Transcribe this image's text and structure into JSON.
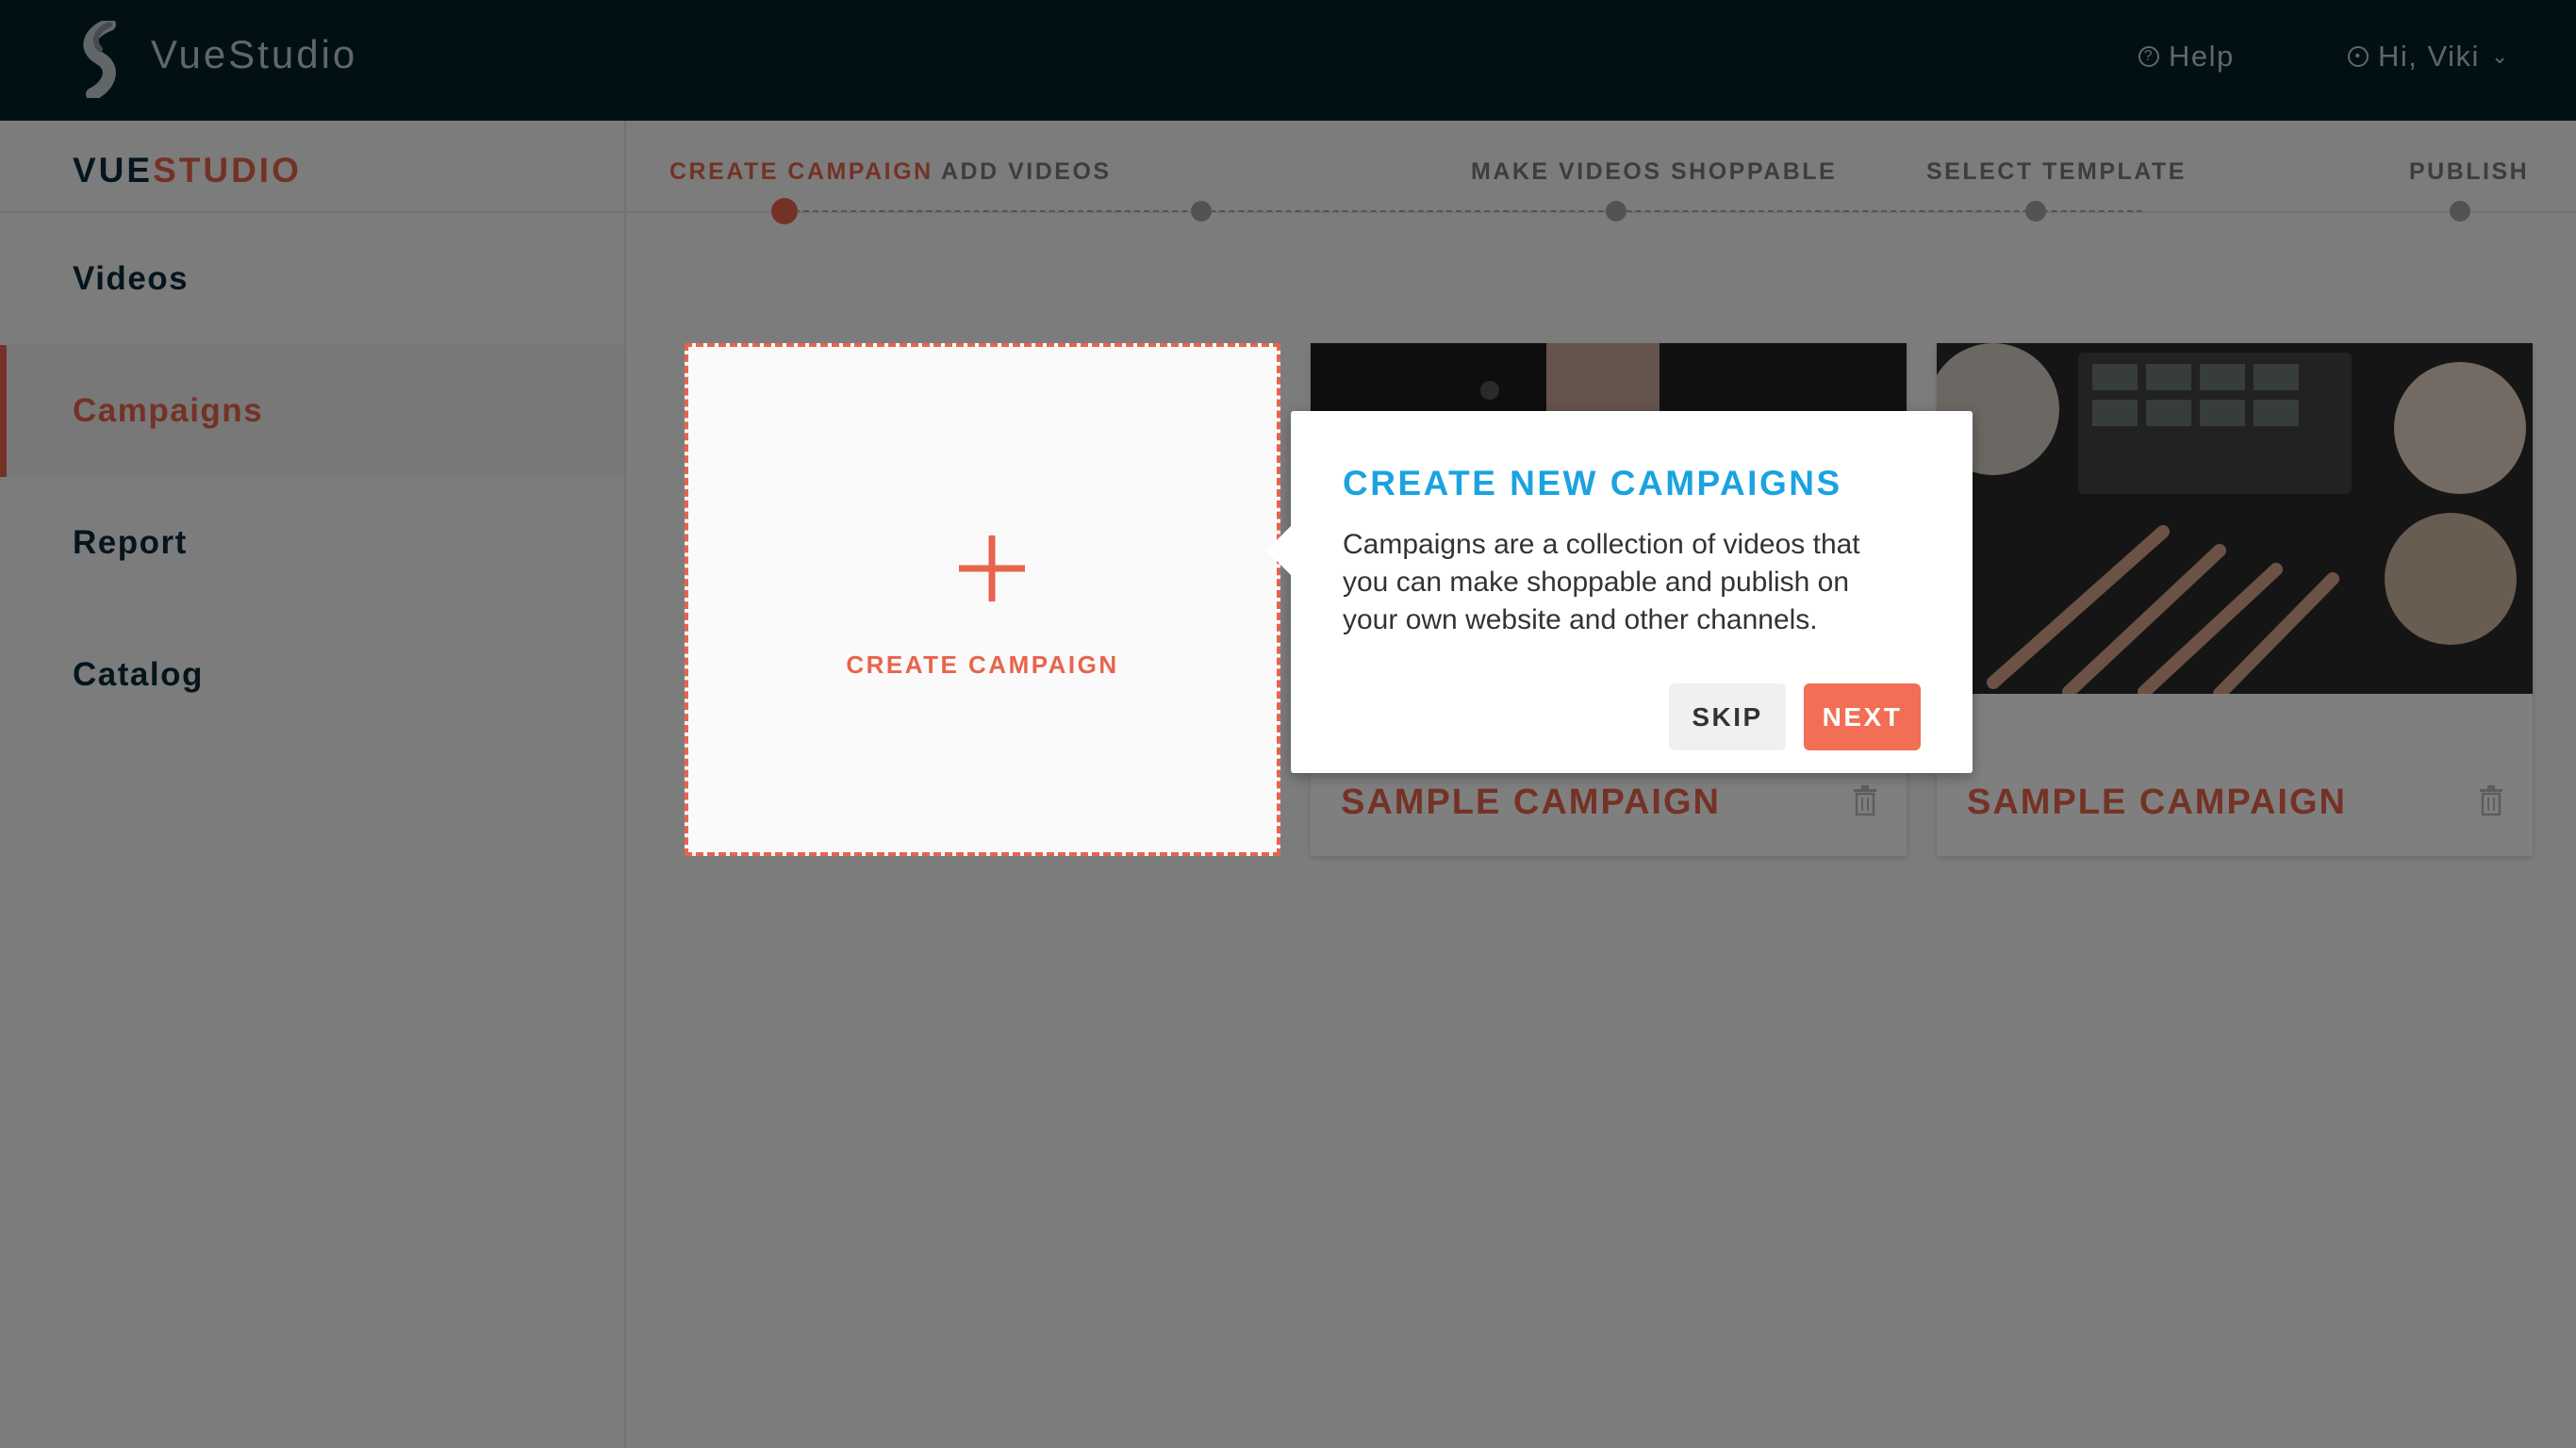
{
  "header": {
    "app_name": "VueStudio",
    "help_label": "Help",
    "user_greeting": "Hi, Viki"
  },
  "sidebar": {
    "brand_part1": "VUE",
    "brand_part2": "STUDIO",
    "items": [
      {
        "label": "Videos",
        "active": false
      },
      {
        "label": "Campaigns",
        "active": true
      },
      {
        "label": "Report",
        "active": false
      },
      {
        "label": "Catalog",
        "active": false
      }
    ]
  },
  "stepper": {
    "steps": [
      {
        "label": "CREATE CAMPAIGN",
        "active": true
      },
      {
        "label": "ADD VIDEOS",
        "active": false
      },
      {
        "label": "MAKE VIDEOS SHOPPABLE",
        "active": false
      },
      {
        "label": "SELECT TEMPLATE",
        "active": false
      },
      {
        "label": "PUBLISH",
        "active": false
      }
    ]
  },
  "main": {
    "create_card_label": "CREATE CAMPAIGN",
    "campaigns": [
      {
        "title": "SAMPLE CAMPAIGN"
      },
      {
        "title": "SAMPLE CAMPAIGN"
      }
    ]
  },
  "popover": {
    "title": "CREATE NEW CAMPAIGNS",
    "body": "Campaigns are a collection of videos that you can make shoppable and publish on your own website and other channels.",
    "skip_label": "SKIP",
    "next_label": "NEXT"
  },
  "colors": {
    "accent": "#e8644c",
    "topbar": "#00202b",
    "popover_title": "#1aa3e0"
  }
}
